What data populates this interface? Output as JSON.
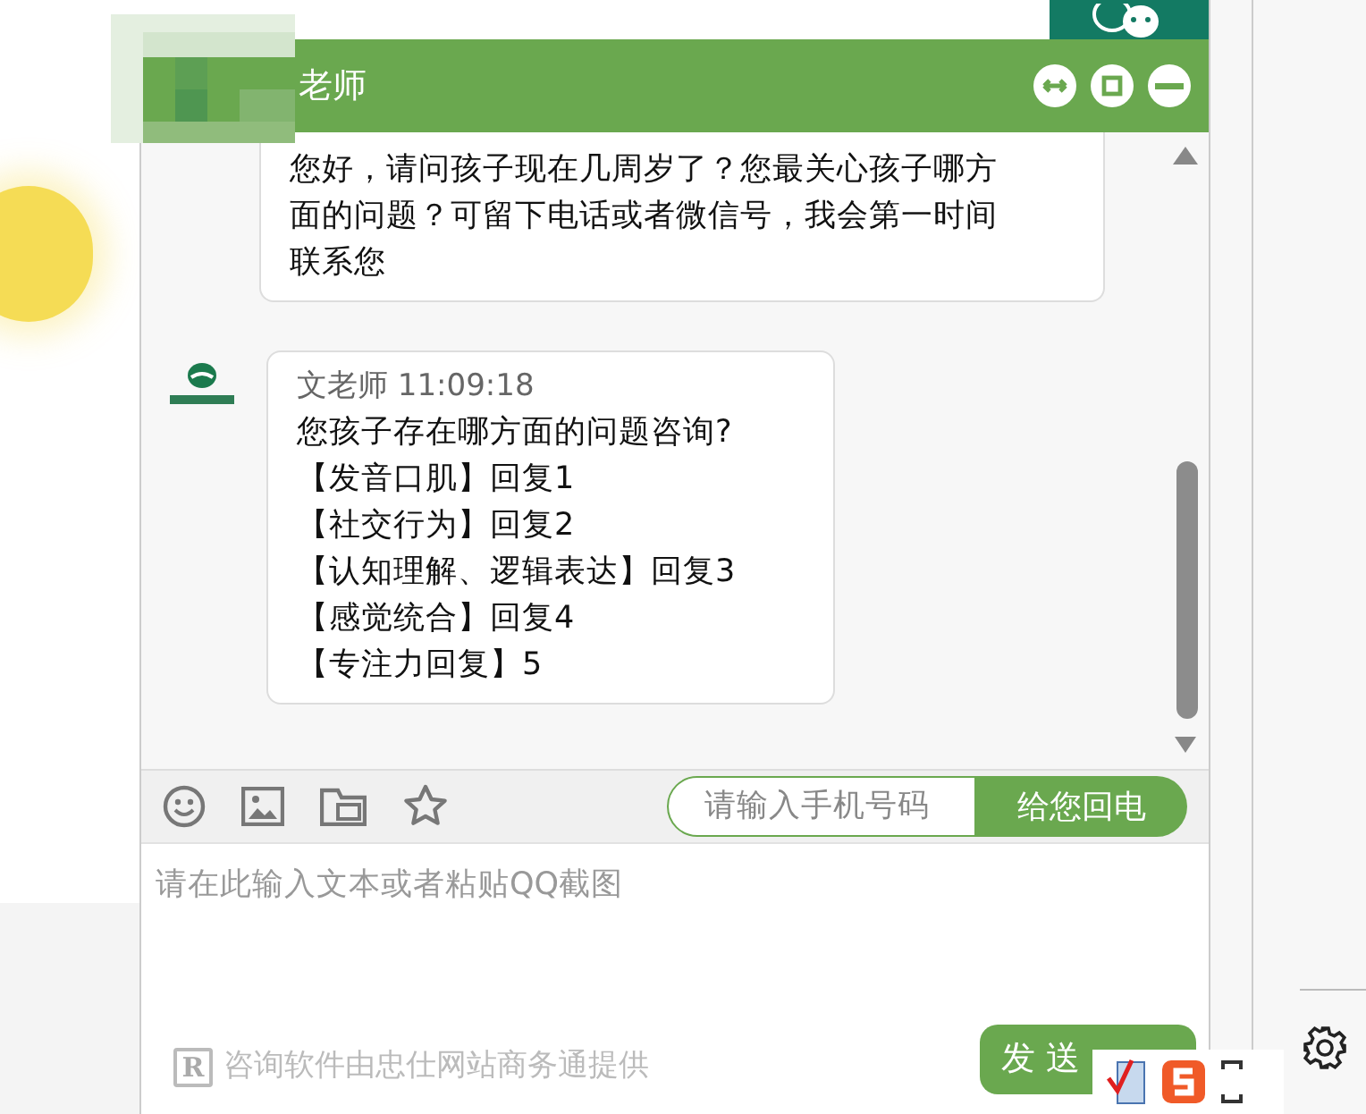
{
  "window": {
    "title": "老师"
  },
  "messages": [
    {
      "kind": "continued",
      "lines": [
        "您好，请问孩子现在几周岁了？您最关心孩子哪方面的问题？可留下电话或者微信号，我会第一时间联系您"
      ]
    },
    {
      "kind": "full",
      "sender": "文老师 11:09:18",
      "lines": [
        "您孩子存在哪方面的问题咨询?",
        "【发音口肌】回复1",
        "【社交行为】回复2",
        "【认知理解、逻辑表达】回复3",
        "【感觉统合】回复4",
        "【专注力回复】5"
      ]
    }
  ],
  "callback": {
    "placeholder": "请输入手机号码",
    "button": "给您回电"
  },
  "composer": {
    "placeholder": "请在此输入文本或者粘贴QQ截图"
  },
  "footer": {
    "badge": "R",
    "text": "咨询软件由忠仕网站商务通提供"
  },
  "send_button": "发 送"
}
